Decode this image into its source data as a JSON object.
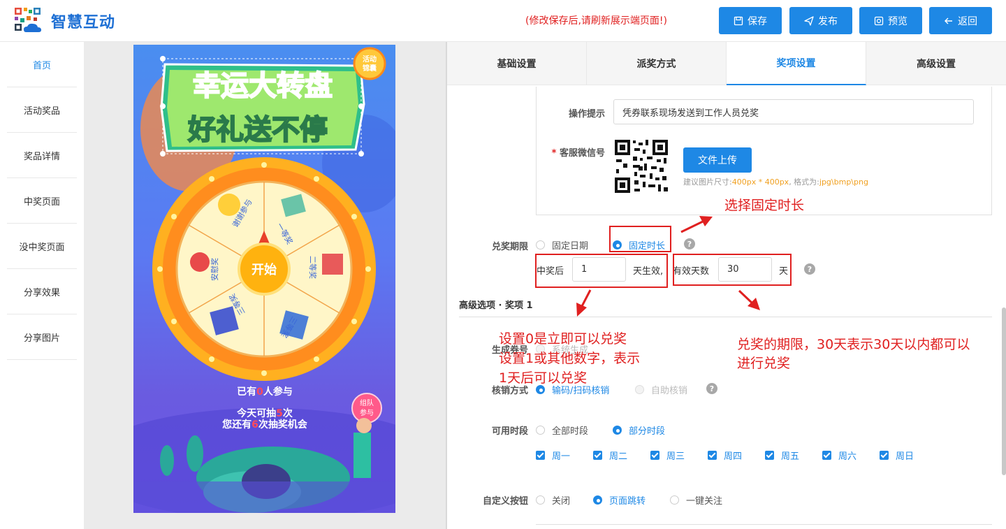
{
  "header": {
    "brand": "智慧互动",
    "notice": "(修改保存后,请刷新展示端页面!)",
    "buttons": {
      "save": "保存",
      "publish": "发布",
      "preview": "预览",
      "back": "返回"
    }
  },
  "nav": {
    "items": [
      "首页",
      "活动奖品",
      "奖品详情",
      "中奖页面",
      "没中奖页面",
      "分享效果",
      "分享图片"
    ],
    "active_index": 0
  },
  "preview": {
    "title_line1": "幸运大转盘",
    "title_line2": "好礼送不停",
    "badge": "活动锦囊",
    "spin_button": "开始",
    "wheel_segments": [
      "谢谢参与",
      "一等奖",
      "二等奖",
      "三等奖",
      "三等奖",
      "安慰奖"
    ],
    "joined_prefix": "已有",
    "joined_count": "0",
    "joined_suffix": "人参与",
    "today_prefix": "今天可抽",
    "today_count": "5",
    "today_suffix": "次",
    "remain_prefix": "您还有",
    "remain_count": "6",
    "remain_suffix": "次抽奖机会",
    "team_button": "组队参与"
  },
  "tabs": [
    "基础设置",
    "派奖方式",
    "奖项设置",
    "高级设置"
  ],
  "active_tab": 2,
  "form": {
    "op_hint_label": "操作提示",
    "op_hint_value": "凭券联系现场发送到工作人员兑奖",
    "wechat_label": "客服微信号",
    "required_mark": "*",
    "upload_button": "文件上传",
    "upload_hint_prefix": "建议图片尺寸:",
    "upload_hint_size": "400px * 400px",
    "upload_hint_mid": ", 格式为:",
    "upload_hint_format": "jpg\\bmp\\png",
    "period_label": "兑奖期限",
    "period_fixed_date": "固定日期",
    "period_fixed_duration": "固定时长",
    "after_win_label": "中奖后",
    "after_win_value": "1",
    "effective_suffix": "天生效,",
    "valid_days_label": "有效天数",
    "valid_days_value": "30",
    "day_unit": "天",
    "advanced_title": "高级选项 · 奖项 1",
    "gen_label": "生成券号",
    "gen_option": "系统生成",
    "verify_label": "核销方式",
    "verify_scan": "输码/扫码核销",
    "verify_self": "自助核销",
    "time_label": "可用时段",
    "time_all": "全部时段",
    "time_partial": "部分时段",
    "weekdays": [
      "周一",
      "周二",
      "周三",
      "周四",
      "周五",
      "周六",
      "周日"
    ],
    "custom_label": "自定义按钮",
    "custom_off": "关闭",
    "custom_jump": "页面跳转",
    "custom_follow": "一键关注"
  },
  "annotations": {
    "choose": "选择固定时长",
    "setting_l1": "设置0是立即可以兑奖",
    "setting_l2": "设置1或其他数字，表示",
    "setting_l3": "1天后可以兑奖",
    "period_l1": "兑奖的期限，30天表示30天以内都可以",
    "period_l2": "进行兑奖"
  },
  "colors": {
    "accent": "#1e88e5",
    "annotation": "#e02020"
  }
}
